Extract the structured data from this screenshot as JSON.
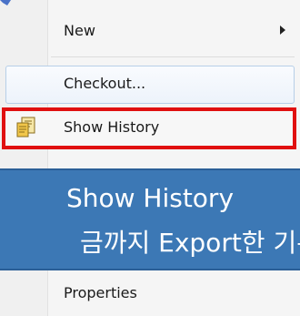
{
  "menu": {
    "items": [
      {
        "label": "New",
        "has_submenu": true
      },
      {
        "label": "Checkout...",
        "state": "hovered"
      },
      {
        "label": "Show History",
        "icon": "history-document-icon",
        "highlight": "red-outline"
      },
      {
        "label": "Properties"
      }
    ]
  },
  "callout": {
    "title": "Show History",
    "subtitle": "금까지 Export한 기록"
  },
  "colors": {
    "callout_bg": "#3c78b5",
    "highlight_border": "#e01010",
    "hover_border": "#b7cfe8",
    "menu_bg": "#f5f5f5"
  }
}
